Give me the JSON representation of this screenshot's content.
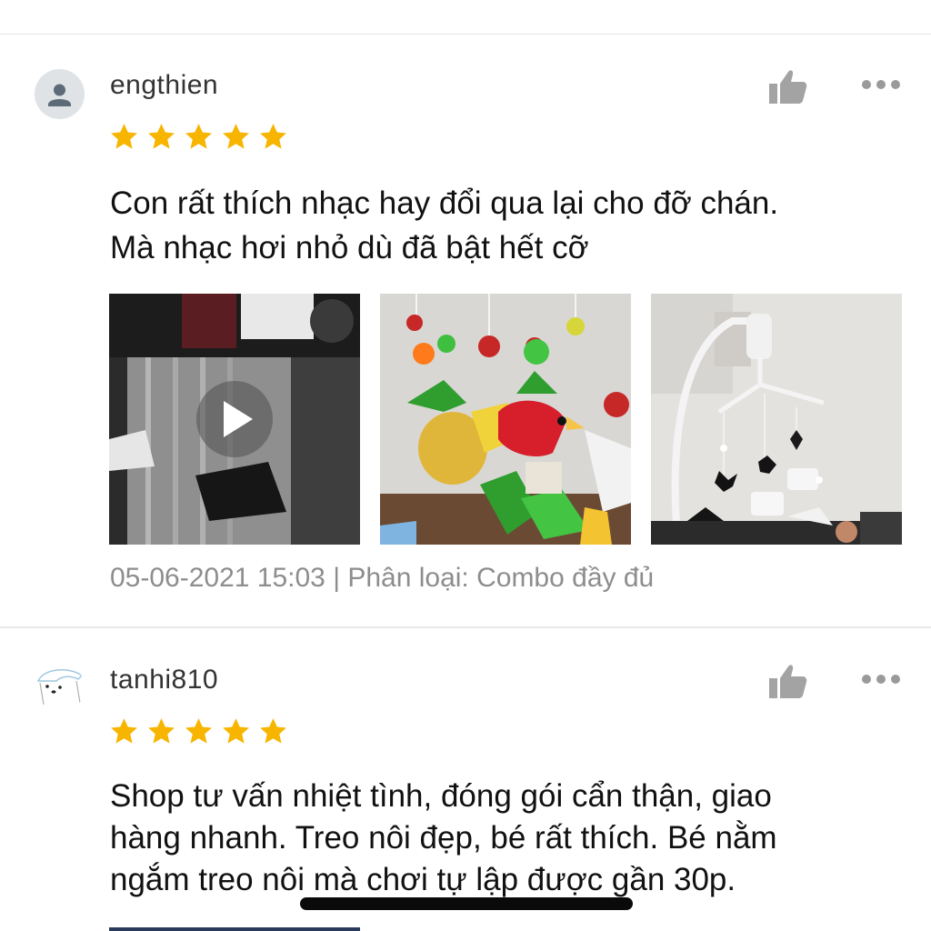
{
  "colors": {
    "star": "#f7b500",
    "meta_text": "#8d8d8d",
    "icon_gray": "#9a9a9a"
  },
  "reviews": [
    {
      "username": "engthien",
      "rating": 5,
      "text_line1": "Con rất thích nhạc hay đổi qua lại cho đỡ chán.",
      "text_line2": "Mà nhạc hơi nhỏ dù đã bật hết cỡ",
      "meta": "05-06-2021 15:03 | Phân loại: Combo đầy đủ",
      "media": [
        {
          "type": "video",
          "icon": "play-icon"
        },
        {
          "type": "image"
        },
        {
          "type": "image"
        }
      ]
    },
    {
      "username": "tanhi810",
      "rating": 5,
      "text_line1": "Shop tư vấn nhiệt tình, đóng gói cẩn thận, giao",
      "text_line2": "hàng nhanh. Treo nôi đẹp, bé rất thích. Bé nằm",
      "text_line3": "ngắm treo nôi mà chơi tự lập được gần 30p."
    }
  ],
  "icons": {
    "like": "thumbs-up-icon",
    "more": "more-dots-icon",
    "avatar_default": "user-icon",
    "star": "star-icon"
  }
}
